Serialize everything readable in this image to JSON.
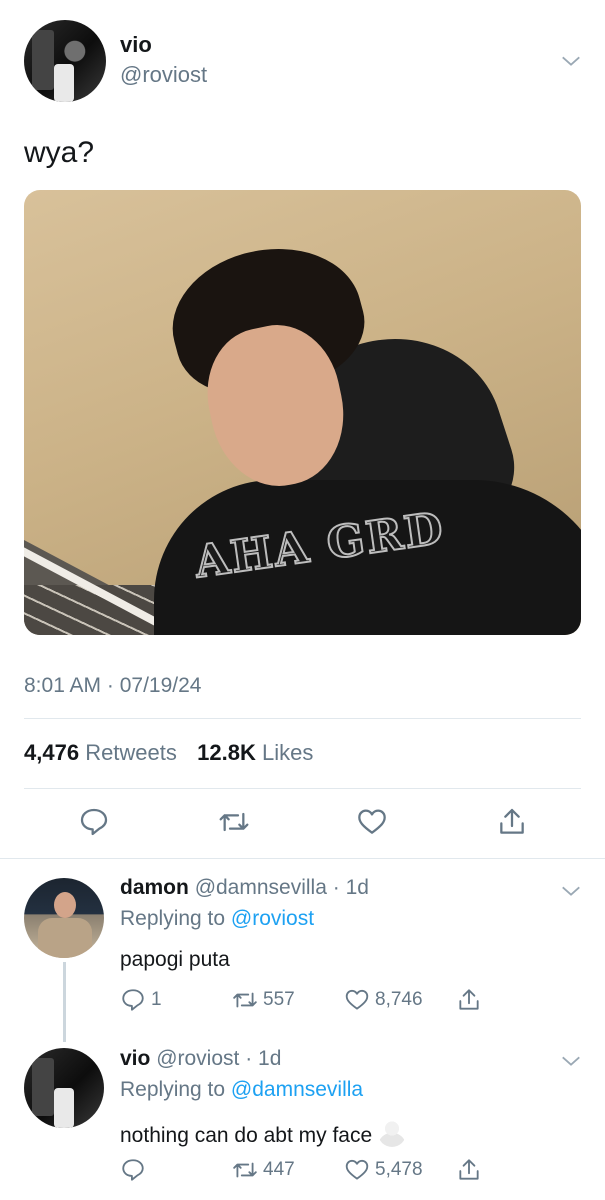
{
  "main_tweet": {
    "author_name": "vio",
    "author_handle": "@roviost",
    "text": "wya?",
    "media_text": "AHA GRD",
    "timestamp": "8:01 AM · 07/19/24",
    "retweet_count": "4,476",
    "retweet_label": "Retweets",
    "like_count": "12.8K",
    "like_label": "Likes",
    "actions": [
      "reply-icon",
      "retweet-icon",
      "like-icon",
      "share-icon"
    ]
  },
  "replies": [
    {
      "author_name": "damon",
      "author_handle": "@damnsevilla",
      "time": "1d",
      "replying_prefix": "Replying to",
      "replying_to": "@roviost",
      "text": "papogi puta",
      "reply_count": "1",
      "retweet_count": "557",
      "like_count": "8,746"
    },
    {
      "author_name": "vio",
      "author_handle": "@roviost",
      "time": "1d",
      "replying_prefix": "Replying to",
      "replying_to": "@damnsevilla",
      "text": "nothing can do abt my face",
      "reply_count": "",
      "retweet_count": "447",
      "like_count": "5,478"
    }
  ],
  "colors": {
    "text_primary": "#14171a",
    "text_secondary": "#657786",
    "link": "#1da1f2",
    "divider": "#e1e8ed"
  }
}
